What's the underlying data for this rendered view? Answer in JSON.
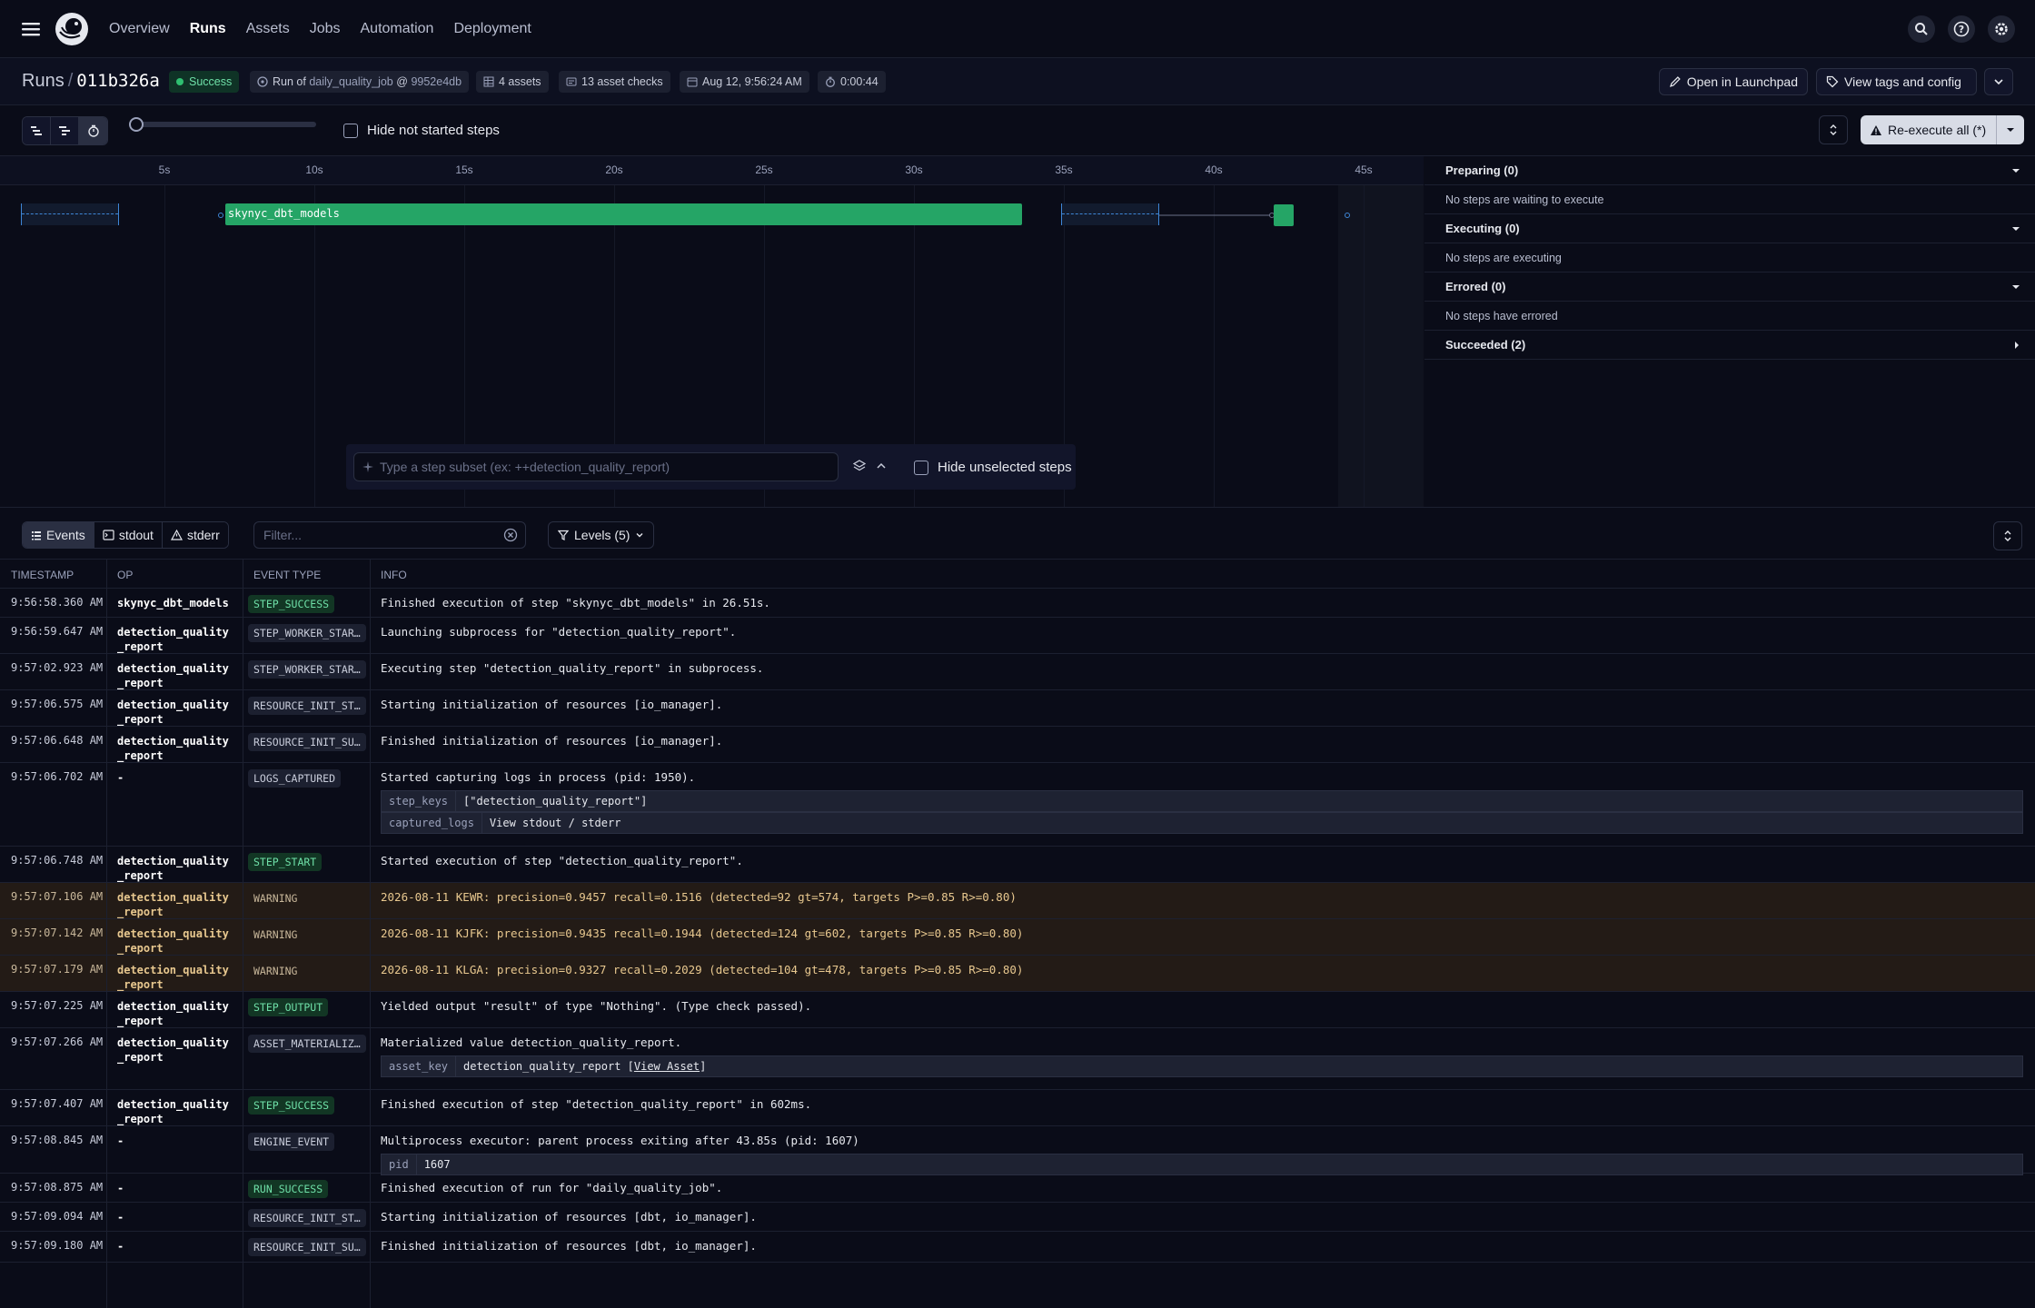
{
  "nav": {
    "links": [
      "Overview",
      "Runs",
      "Assets",
      "Jobs",
      "Automation",
      "Deployment"
    ]
  },
  "run": {
    "crumb_runs": "Runs",
    "crumb_sep": "/",
    "run_id": "011b326a",
    "status": "Success",
    "run_of_prefix": "Run of",
    "job": "daily_quality_job",
    "job_at": "@",
    "snapshot": "9952e4db",
    "assets": "4 assets",
    "checks": "13 asset checks",
    "started": "Aug 12, 9:56:24 AM",
    "duration": "0:00:44",
    "open_launchpad": "Open in Launchpad",
    "view_tags": "View tags and config"
  },
  "toolbar": {
    "hide_not_started": "Hide not started steps",
    "reexecute": "Re-execute all (*)",
    "slider_level": 0
  },
  "gantt": {
    "ticks": [
      "5s",
      "10s",
      "15s",
      "20s",
      "25s",
      "30s",
      "35s",
      "40s",
      "45s"
    ],
    "step_label": "skynyc_dbt_models",
    "subset_placeholder": "Type a step subset (ex: ++detection_quality_report)",
    "hide_unselected": "Hide unselected steps"
  },
  "side": [
    {
      "title": "Preparing (0)",
      "body": "No steps are waiting to execute",
      "open": true
    },
    {
      "title": "Executing (0)",
      "body": "No steps are executing",
      "open": true
    },
    {
      "title": "Errored (0)",
      "body": "No steps have errored",
      "open": true
    },
    {
      "title": "Succeeded (2)",
      "body": "",
      "open": false
    }
  ],
  "events_bar": {
    "tabs": [
      "Events",
      "stdout",
      "stderr"
    ],
    "filter_placeholder": "Filter...",
    "levels": "Levels (5)"
  },
  "table": {
    "headers": [
      "TIMESTAMP",
      "OP",
      "EVENT TYPE",
      "INFO"
    ],
    "rows": [
      {
        "ts": "9:56:58.360 AM",
        "op": "skynyc_dbt_models",
        "type": "STEP_SUCCESS",
        "info": "Finished execution of step \"skynyc_dbt_models\" in 26.51s."
      },
      {
        "ts": "9:56:59.647 AM",
        "op": "detection_quality_report",
        "type": "STEP_WORKER_STARTING",
        "info": "Launching subprocess for \"detection_quality_report\"."
      },
      {
        "ts": "9:57:02.923 AM",
        "op": "detection_quality_report",
        "type": "STEP_WORKER_STARTED",
        "info": "Executing step \"detection_quality_report\" in subprocess."
      },
      {
        "ts": "9:57:06.575 AM",
        "op": "detection_quality_report",
        "type": "RESOURCE_INIT_STARTED",
        "info": "Starting initialization of resources [io_manager]."
      },
      {
        "ts": "9:57:06.648 AM",
        "op": "detection_quality_report",
        "type": "RESOURCE_INIT_SUCCESS",
        "info": "Finished initialization of resources [io_manager]."
      },
      {
        "ts": "9:57:06.702 AM",
        "op": "-",
        "type": "LOGS_CAPTURED",
        "info": "Started capturing logs in process (pid: 1950).",
        "kv": [
          {
            "k": "step_keys",
            "v": "[\"detection_quality_report\"]"
          },
          {
            "k": "captured_logs",
            "v": "View stdout / stderr"
          }
        ]
      },
      {
        "ts": "9:57:06.748 AM",
        "op": "detection_quality_report",
        "type": "STEP_START",
        "info": "Started execution of step \"detection_quality_report\"."
      },
      {
        "ts": "9:57:07.106 AM",
        "op": "detection_quality_report",
        "type": "WARNING",
        "info": "2026-08-11 KEWR: precision=0.9457 recall=0.1516 (detected=92 gt=574, targets P>=0.85 R>=0.80)"
      },
      {
        "ts": "9:57:07.142 AM",
        "op": "detection_quality_report",
        "type": "WARNING",
        "info": "2026-08-11 KJFK: precision=0.9435 recall=0.1944 (detected=124 gt=602, targets P>=0.85 R>=0.80)"
      },
      {
        "ts": "9:57:07.179 AM",
        "op": "detection_quality_report",
        "type": "WARNING",
        "info": "2026-08-11 KLGA: precision=0.9327 recall=0.2029 (detected=104 gt=478, targets P>=0.85 R>=0.80)"
      },
      {
        "ts": "9:57:07.225 AM",
        "op": "detection_quality_report",
        "type": "STEP_OUTPUT",
        "info": "Yielded output \"result\" of type \"Nothing\". (Type check passed)."
      },
      {
        "ts": "9:57:07.266 AM",
        "op": "detection_quality_report",
        "type": "ASSET_MATERIALIZATION",
        "info": "Materialized value detection_quality_report.",
        "kv": [
          {
            "k": "asset_key",
            "v": "detection_quality_report [",
            "link": "View Asset",
            "tail": "]"
          }
        ]
      },
      {
        "ts": "9:57:07.407 AM",
        "op": "detection_quality_report",
        "type": "STEP_SUCCESS",
        "info": "Finished execution of step \"detection_quality_report\" in 602ms."
      },
      {
        "ts": "9:57:08.845 AM",
        "op": "-",
        "type": "ENGINE_EVENT",
        "info": "Multiprocess executor: parent process exiting after 43.85s (pid: 1607)",
        "kv": [
          {
            "k": "pid",
            "v": "1607"
          }
        ]
      },
      {
        "ts": "9:57:08.875 AM",
        "op": "-",
        "type": "RUN_SUCCESS",
        "info": "Finished execution of run for \"daily_quality_job\"."
      },
      {
        "ts": "9:57:09.094 AM",
        "op": "-",
        "type": "RESOURCE_INIT_STARTED",
        "info": "Starting initialization of resources [dbt, io_manager]."
      },
      {
        "ts": "9:57:09.180 AM",
        "op": "-",
        "type": "RESOURCE_INIT_SUCCESS",
        "info": "Finished initialization of resources [dbt, io_manager]."
      }
    ]
  },
  "colors": {
    "success": "#25a566",
    "accent_blue": "#3e86d6",
    "warning_bg": "#231b16"
  }
}
